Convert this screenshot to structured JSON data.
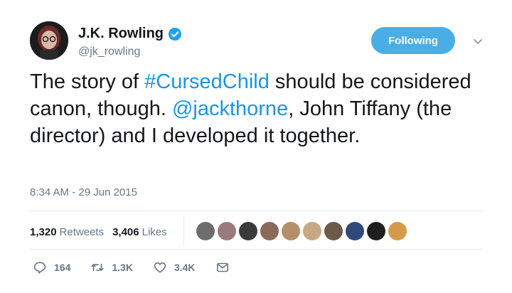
{
  "author": {
    "display_name": "J.K. Rowling",
    "handle": "@jk_rowling",
    "verified": true
  },
  "follow_button": {
    "label": "Following",
    "color": "#4aaee6"
  },
  "tweet": {
    "segments": [
      {
        "text": "The story of ",
        "type": "text"
      },
      {
        "text": "#CursedChild",
        "type": "hashtag"
      },
      {
        "text": " should be considered canon, though. ",
        "type": "text"
      },
      {
        "text": "@jackthorne",
        "type": "mention"
      },
      {
        "text": ", John Tiffany (the director) and I developed it together.",
        "type": "text"
      }
    ],
    "link_color": "#1b95e0"
  },
  "timestamp": "8:34 AM - 29 Jun 2015",
  "stats": {
    "retweets_count": "1,320",
    "retweets_label": "Retweets",
    "likes_count": "3,406",
    "likes_label": "Likes"
  },
  "liker_avatars": [
    {
      "icon": "avatar-icon",
      "color": "#6d6d6d"
    },
    {
      "icon": "avatar-icon",
      "color": "#9a7a7a"
    },
    {
      "icon": "avatar-icon",
      "color": "#3a3a3a"
    },
    {
      "icon": "avatar-icon",
      "color": "#8a6a5a"
    },
    {
      "icon": "avatar-icon",
      "color": "#b58f6a"
    },
    {
      "icon": "avatar-icon",
      "color": "#c8a882"
    },
    {
      "icon": "avatar-icon",
      "color": "#6d5a4a"
    },
    {
      "icon": "avatar-icon",
      "color": "#2f4a7a"
    },
    {
      "icon": "avatar-icon",
      "color": "#1f1f1f"
    },
    {
      "icon": "avatar-icon",
      "color": "#d69a4a"
    }
  ],
  "actions": {
    "reply_count": "164",
    "retweet_count": "1.3K",
    "like_count": "3.4K"
  },
  "icons": {
    "verified": "verified-badge-icon",
    "caret": "chevron-down-icon",
    "reply": "reply-icon",
    "retweet": "retweet-icon",
    "like": "heart-icon",
    "dm": "envelope-icon"
  }
}
